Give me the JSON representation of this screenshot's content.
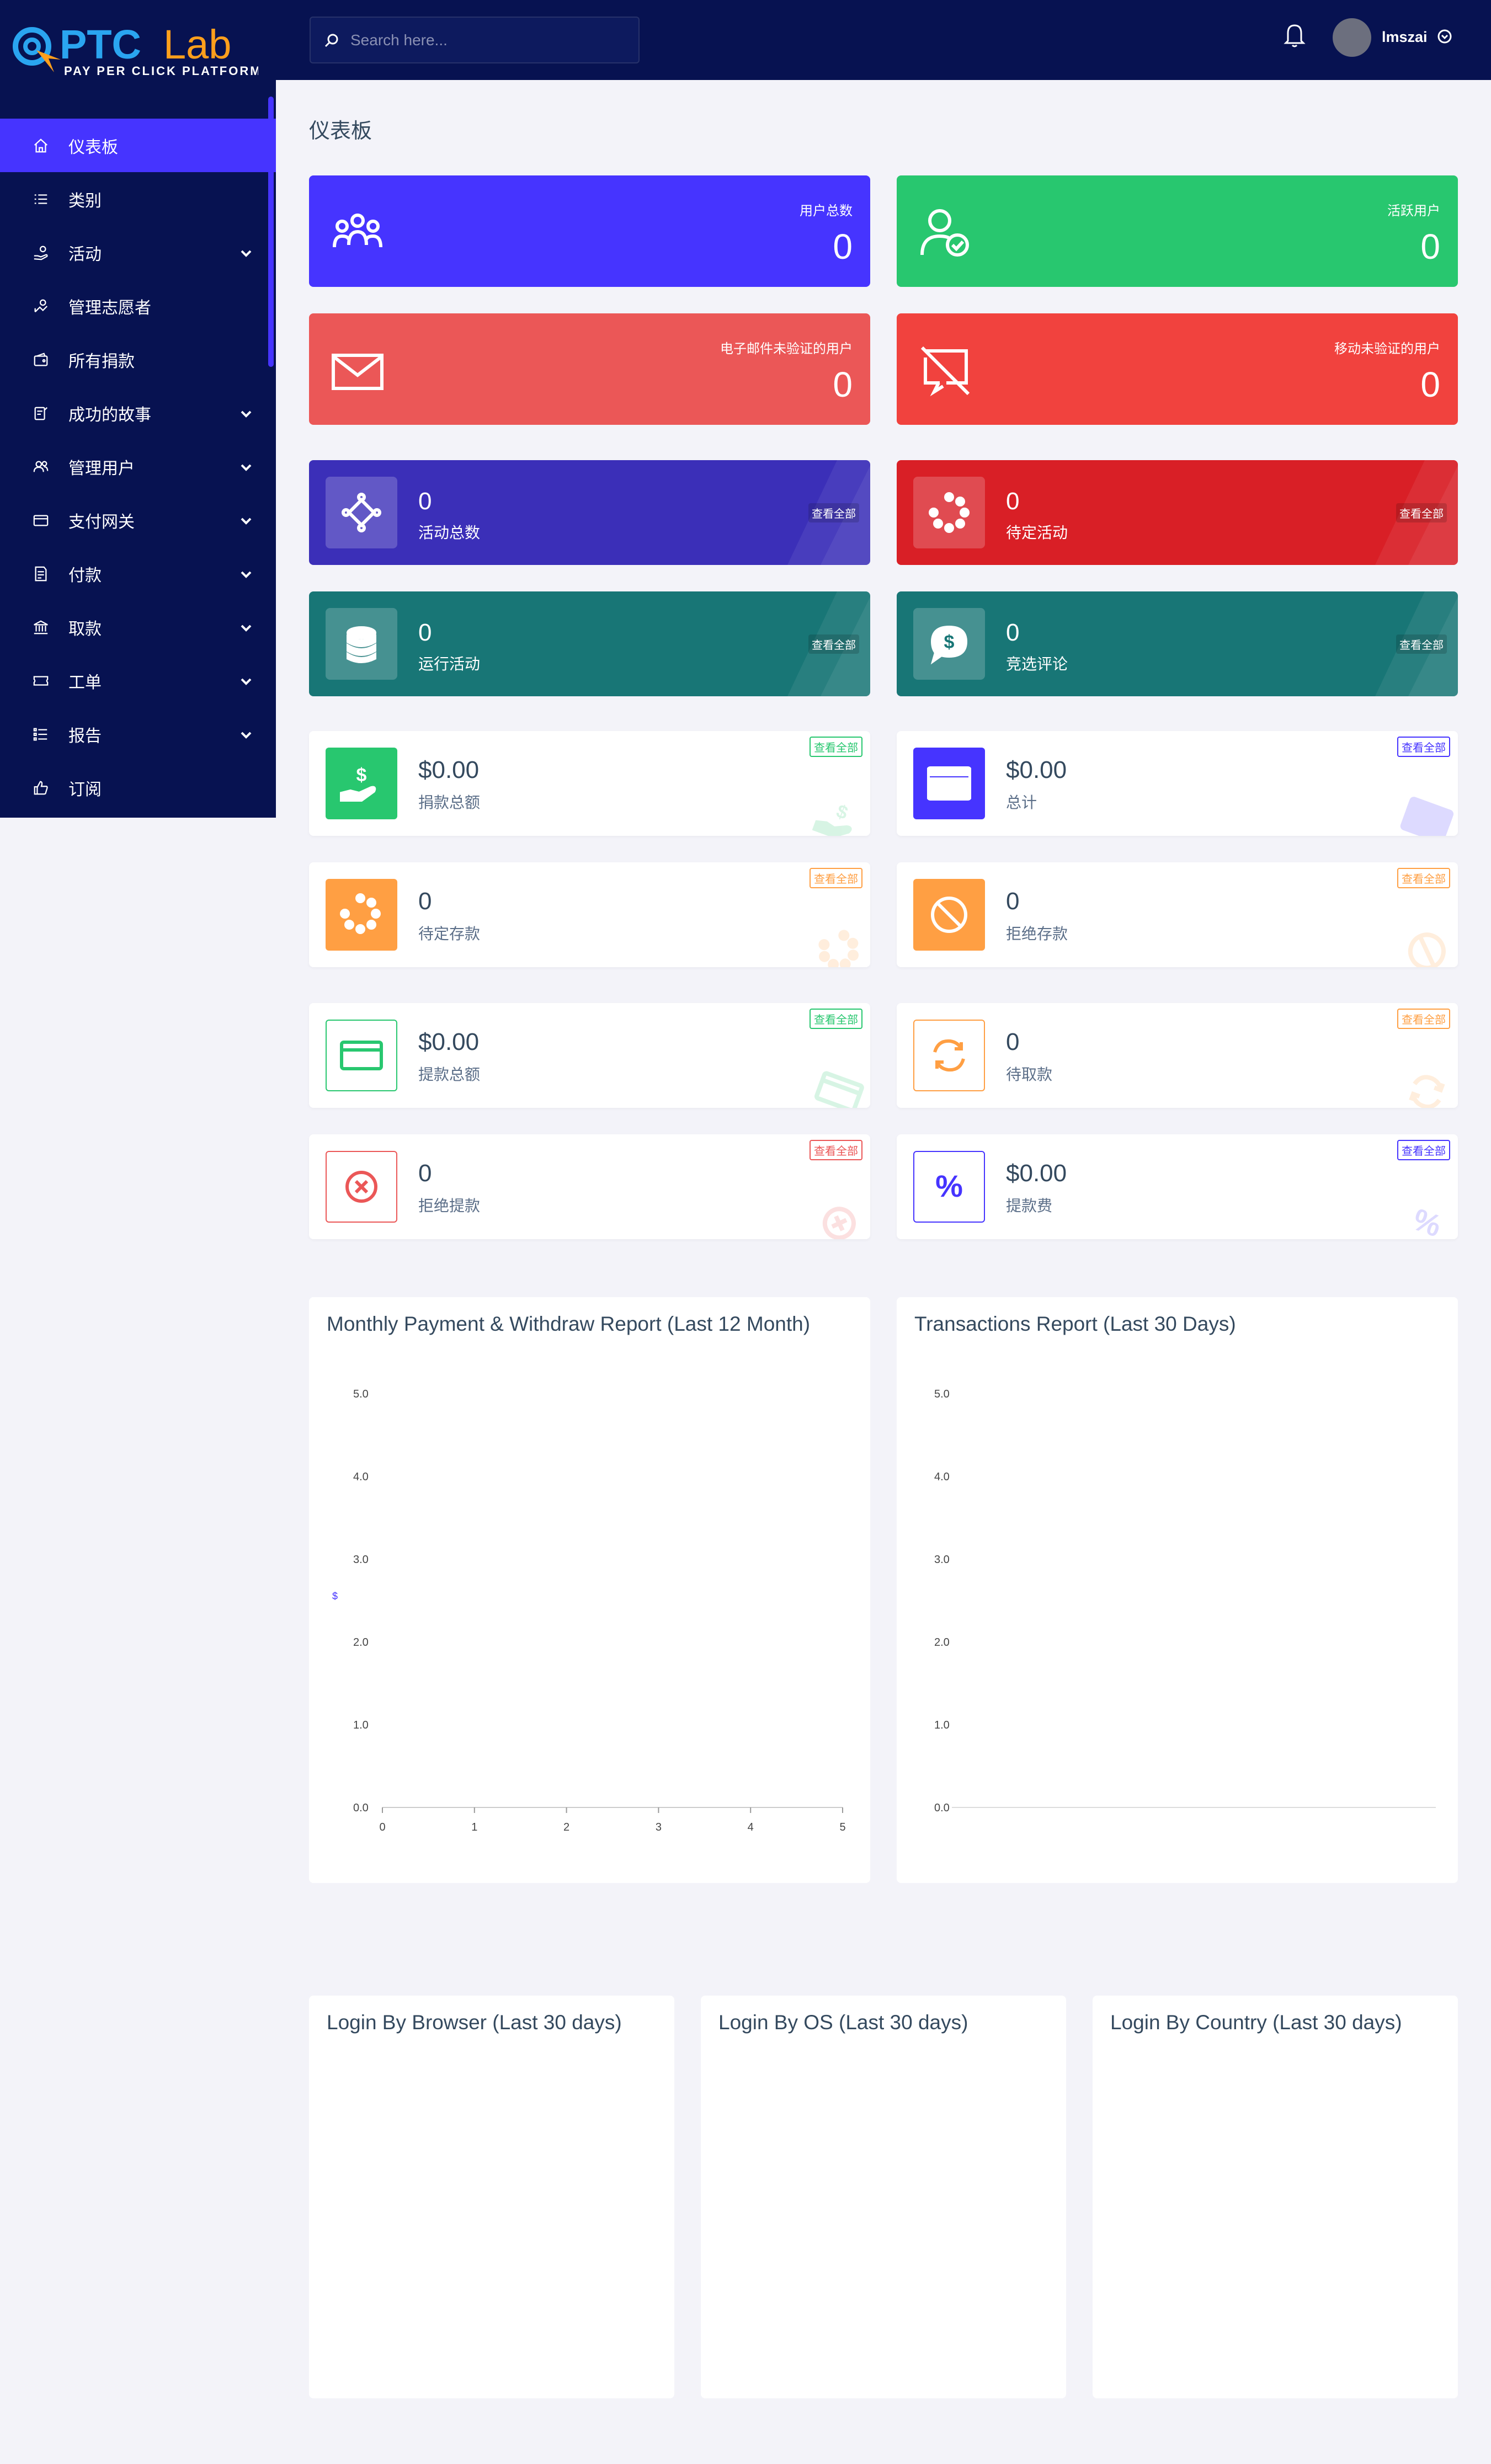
{
  "logo": {
    "name_part1": "PTC",
    "name_part2": "Lab",
    "tagline": "PAY PER CLICK PLATFORM"
  },
  "search": {
    "placeholder": "Search here..."
  },
  "user": {
    "name": "lmszai"
  },
  "page_title": "仪表板",
  "sidebar": {
    "items": [
      {
        "label": "仪表板",
        "icon": "home-icon",
        "active": true,
        "expand": false
      },
      {
        "label": "类别",
        "icon": "list-icon",
        "active": false,
        "expand": false
      },
      {
        "label": "活动",
        "icon": "hand-coin-icon",
        "active": false,
        "expand": true
      },
      {
        "label": "管理志愿者",
        "icon": "volunteer-icon",
        "active": false,
        "expand": false
      },
      {
        "label": "所有捐款",
        "icon": "wallet-icon",
        "active": false,
        "expand": false
      },
      {
        "label": "成功的故事",
        "icon": "story-icon",
        "active": false,
        "expand": true
      },
      {
        "label": "管理用户",
        "icon": "users-icon",
        "active": false,
        "expand": true
      },
      {
        "label": "支付网关",
        "icon": "card-icon",
        "active": false,
        "expand": true
      },
      {
        "label": "付款",
        "icon": "invoice-icon",
        "active": false,
        "expand": true
      },
      {
        "label": "取款",
        "icon": "bank-icon",
        "active": false,
        "expand": true
      },
      {
        "label": "工单",
        "icon": "ticket-icon",
        "active": false,
        "expand": true
      },
      {
        "label": "报告",
        "icon": "report-list-icon",
        "active": false,
        "expand": true
      },
      {
        "label": "订阅",
        "icon": "thumbs-up-icon",
        "active": false,
        "expand": false
      }
    ]
  },
  "stats": [
    {
      "label": "用户总数",
      "value": "0",
      "color": "#4634ff",
      "icon": "users-icon"
    },
    {
      "label": "活跃用户",
      "value": "0",
      "color": "#28c76f",
      "icon": "user-check-icon"
    },
    {
      "label": "电子邮件未验证的用户",
      "value": "0",
      "color": "#eb5757",
      "icon": "envelope-icon"
    },
    {
      "label": "移动未验证的用户",
      "value": "0",
      "color": "#f1423e",
      "icon": "mobile-off-icon"
    }
  ],
  "widgets": [
    {
      "value": "0",
      "label": "活动总数",
      "view_all": "查看全部",
      "color": "#3b2fb8",
      "icon": "campaign-icon"
    },
    {
      "value": "0",
      "label": "待定活动",
      "view_all": "查看全部",
      "color": "#d91f26",
      "icon": "spinner-icon"
    },
    {
      "value": "0",
      "label": "运行活动",
      "view_all": "查看全部",
      "color": "#187676",
      "icon": "coins-icon"
    },
    {
      "value": "0",
      "label": "竞选评论",
      "view_all": "查看全部",
      "color": "#187676",
      "icon": "dollar-comment-icon"
    }
  ],
  "boxes": [
    {
      "value": "$0.00",
      "label": "捐款总额",
      "view_all": "查看全部",
      "color": "#28c76f",
      "filled": true,
      "icon": "hand-dollar-icon"
    },
    {
      "value": "$0.00",
      "label": "总计",
      "view_all": "查看全部",
      "color": "#4634ff",
      "filled": true,
      "icon": "credit-card-icon"
    },
    {
      "value": "0",
      "label": "待定存款",
      "view_all": "查看全部",
      "color": "#ff9f43",
      "filled": true,
      "icon": "spinner-icon"
    },
    {
      "value": "0",
      "label": "拒绝存款",
      "view_all": "查看全部",
      "color": "#ff9f43",
      "filled": true,
      "icon": "ban-icon"
    },
    {
      "value": "$0.00",
      "label": "提款总额",
      "view_all": "查看全部",
      "color": "#28c76f",
      "filled": false,
      "icon": "wallet-card-icon"
    },
    {
      "value": "0",
      "label": "待取款",
      "view_all": "查看全部",
      "color": "#ff9f43",
      "filled": false,
      "icon": "sync-icon"
    },
    {
      "value": "0",
      "label": "拒绝提款",
      "view_all": "查看全部",
      "color": "#eb5757",
      "filled": false,
      "icon": "times-circle-icon"
    },
    {
      "value": "$0.00",
      "label": "提款费",
      "view_all": "查看全部",
      "color": "#4634ff",
      "filled": false,
      "icon": "percent-icon"
    }
  ],
  "panels": {
    "monthly_title": "Monthly Payment & Withdraw Report (Last 12 Month)",
    "transactions_title": "Transactions Report (Last 30 Days)",
    "browser_title": "Login By Browser (Last 30 days)",
    "os_title": "Login By OS (Last 30 days)",
    "country_title": "Login By Country (Last 30 days)",
    "dollar_marker": "$"
  },
  "chart_data": [
    {
      "type": "line",
      "title": "Monthly Payment & Withdraw Report (Last 12 Month)",
      "x": [
        0,
        1,
        2,
        3,
        4,
        5
      ],
      "y_ticks": [
        "5.0",
        "4.0",
        "3.0",
        "2.0",
        "1.0",
        "0.0"
      ],
      "x_ticks": [
        "0",
        "1",
        "2",
        "3",
        "4",
        "5"
      ],
      "ylim": [
        0,
        5
      ],
      "xlim": [
        0,
        5
      ],
      "series": [],
      "grid": false
    },
    {
      "type": "line",
      "title": "Transactions Report (Last 30 Days)",
      "y_ticks": [
        "5.0",
        "4.0",
        "3.0",
        "2.0",
        "1.0",
        "0.0"
      ],
      "ylim": [
        0,
        5
      ],
      "series": [],
      "grid": false
    }
  ]
}
